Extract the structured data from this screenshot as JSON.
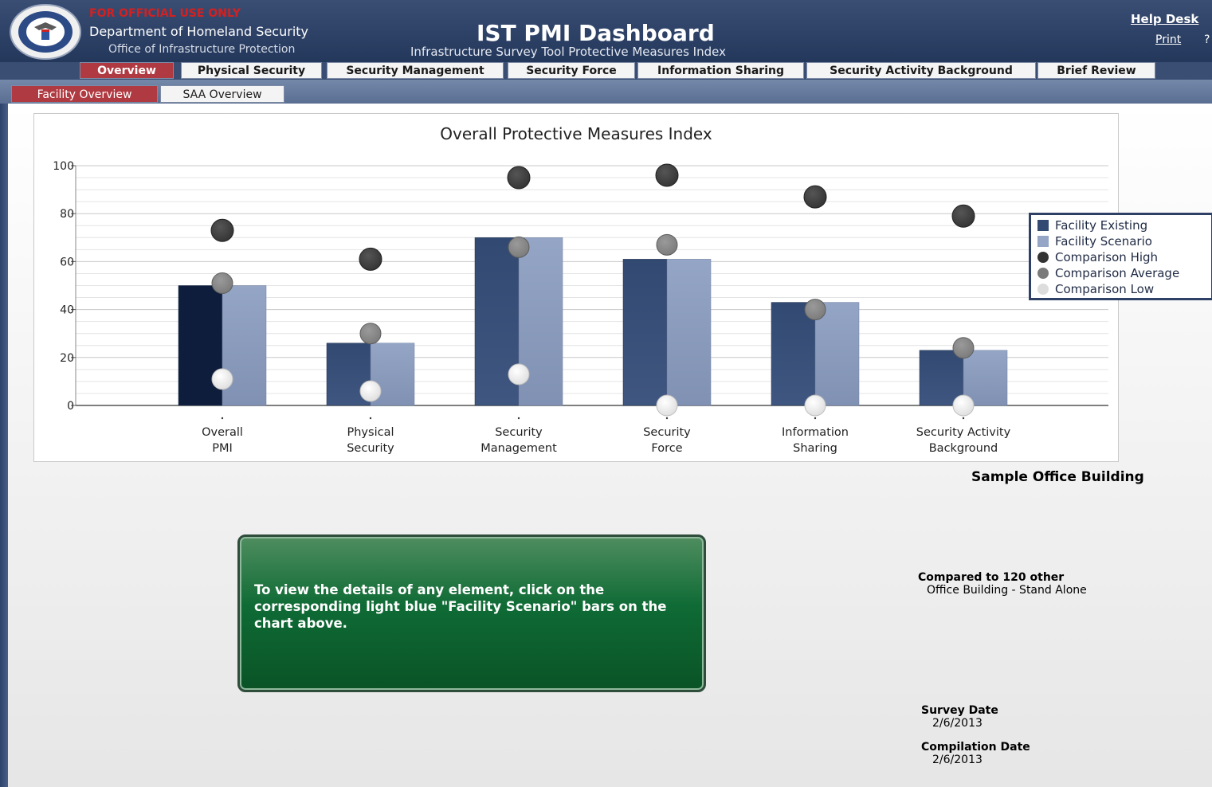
{
  "header": {
    "classification": "FOR OFFICIAL USE ONLY",
    "department": "Department of Homeland Security",
    "office": "Office of Infrastructure Protection",
    "title": "IST PMI Dashboard",
    "subtitle": "Infrastructure Survey Tool Protective Measures Index",
    "help_desk": "Help Desk",
    "print": "Print",
    "help_mark": "?",
    "seal": "dhs-seal-icon"
  },
  "tabs": [
    {
      "label": "Overview",
      "active": true
    },
    {
      "label": "Physical Security",
      "active": false
    },
    {
      "label": "Security Management",
      "active": false
    },
    {
      "label": "Security Force",
      "active": false
    },
    {
      "label": "Information Sharing",
      "active": false
    },
    {
      "label": "Security Activity Background",
      "active": false
    },
    {
      "label": "Brief Review",
      "active": false
    }
  ],
  "subtabs": [
    {
      "label": "Facility Overview",
      "active": true
    },
    {
      "label": "SAA Overview",
      "active": false
    }
  ],
  "colors": {
    "existing": "#324a72",
    "existing_first": "#0e1d3c",
    "scenario": "#94a5c5",
    "high": "#333333",
    "average": "#7a7a7a",
    "low": "#dddddd",
    "accent": "#b03a41"
  },
  "chart_data": {
    "type": "bar",
    "title": "Overall Protective Measures Index",
    "ylim": [
      0,
      100
    ],
    "yticks": [
      0,
      20,
      40,
      60,
      80,
      100
    ],
    "categories": [
      [
        "Overall",
        "PMI"
      ],
      [
        "Physical",
        "Security"
      ],
      [
        "Security",
        "Management"
      ],
      [
        "Security",
        "Force"
      ],
      [
        "Information",
        "Sharing"
      ],
      [
        "Security Activity",
        "Background"
      ]
    ],
    "series": [
      {
        "name": "Facility Existing",
        "kind": "bar",
        "values": [
          50,
          26,
          70,
          61,
          43,
          23
        ]
      },
      {
        "name": "Facility Scenario",
        "kind": "bar",
        "values": [
          50,
          26,
          70,
          61,
          43,
          23
        ]
      },
      {
        "name": "Comparison High",
        "kind": "point",
        "values": [
          73,
          61,
          95,
          96,
          87,
          79
        ]
      },
      {
        "name": "Comparison Average",
        "kind": "point",
        "values": [
          51,
          30,
          66,
          67,
          40,
          24
        ]
      },
      {
        "name": "Comparison Low",
        "kind": "point",
        "values": [
          11,
          6,
          13,
          0,
          0,
          0
        ]
      }
    ],
    "legend_position": "right",
    "grid": true
  },
  "facility_name": "Sample Office Building",
  "notice": "To view the details of any element, click on the corresponding light blue \"Facility Scenario\" bars on the chart above.",
  "comparison": {
    "label": "Compared to 120 other",
    "value": "Office Building - Stand Alone"
  },
  "survey_date": {
    "label": "Survey Date",
    "value": "2/6/2013"
  },
  "compilation_date": {
    "label": "Compilation Date",
    "value": "2/6/2013"
  }
}
